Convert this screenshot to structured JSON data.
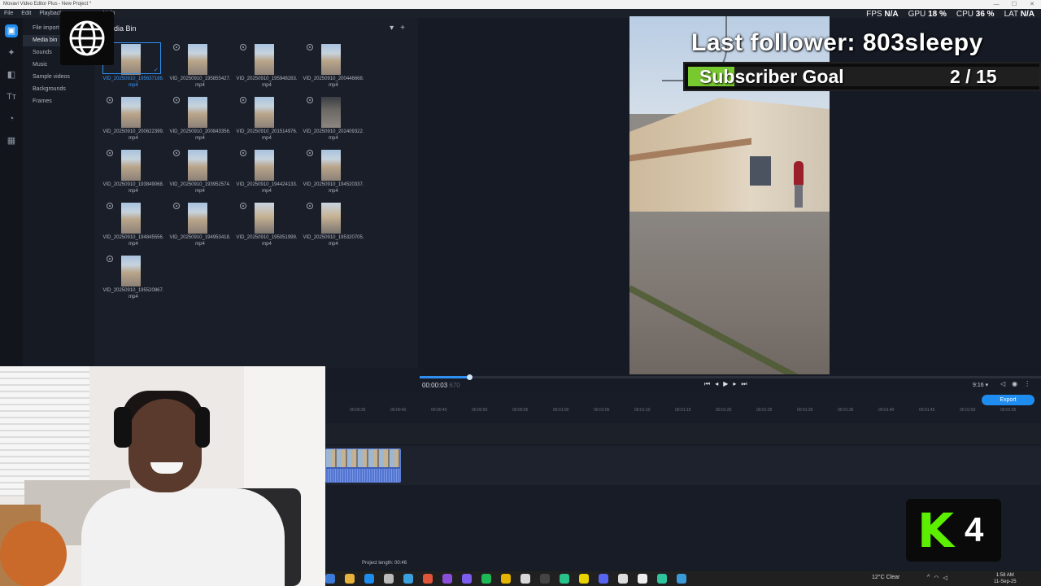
{
  "window": {
    "title": "Movavi Video Editor Plus - New Project *",
    "controls": [
      "—",
      "☐",
      "✕"
    ]
  },
  "menu": [
    "File",
    "Edit",
    "Playback",
    "Help"
  ],
  "stats": [
    {
      "label": "FPS",
      "value": "N/A"
    },
    {
      "label": "GPU",
      "value": "18 %"
    },
    {
      "label": "CPU",
      "value": "36 %"
    },
    {
      "label": "LAT",
      "value": "N/A"
    }
  ],
  "sidebar": {
    "items": [
      "File import",
      "Media bin",
      "Sounds",
      "Music",
      "Sample videos",
      "Backgrounds",
      "Frames"
    ],
    "selected": "Media bin"
  },
  "media_bin": {
    "title": "dia Bin",
    "files": [
      "VID_20250910_195637186.mp4",
      "VID_20250910_195855427.mp4",
      "VID_20250910_195948283.mp4",
      "VID_20250910_200446668.mp4",
      "VID_20250910_200622399.mp4",
      "VID_20250910_200843356.mp4",
      "VID_20250910_201514976.mp4",
      "VID_20250910_202409322.mp4",
      "VID_20250910_193849068.mp4",
      "VID_20250910_193952574.mp4",
      "VID_20250910_194424133.mp4",
      "VID_20250910_194520337.mp4",
      "VID_20250910_194845556.mp4",
      "VID_20250910_194953418.mp4",
      "VID_20250910_195051999.mp4",
      "VID_20250910_195320705.mp4",
      "VID_20250910_195520867.mp4"
    ]
  },
  "overlay": {
    "last_follower": "Last follower: 803sleepy",
    "goal_label": "Subscriber Goal",
    "goal_count": "2 / 15",
    "goal_progress": 0.133,
    "badge_letter": "K",
    "badge_number": "4",
    "goal_color": "#78c830",
    "badge_color": "#5cf000"
  },
  "playback": {
    "current_time": "00:00:03",
    "frames": "670",
    "aspect": "9:16 ▾",
    "progress": 0.08,
    "export_label": "Export"
  },
  "timeline": {
    "ruler": [
      "00:00:35",
      "00:00:40",
      "00:00:45",
      "00:00:50",
      "00:00:55",
      "00:01:00",
      "00:01:05",
      "00:01:10",
      "00:01:15",
      "00:01:20",
      "00:01:25",
      "00:01:30",
      "00:01:35",
      "00:01:40",
      "00:01:45",
      "00:01:50",
      "00:01:55",
      "00:02:00"
    ],
    "project_length": "Project length:  00:46"
  },
  "taskbar": {
    "weather": "12°C  Clear",
    "time": "1:58 AM",
    "date": "11-Sep-25"
  },
  "accent": "#1f8df0"
}
